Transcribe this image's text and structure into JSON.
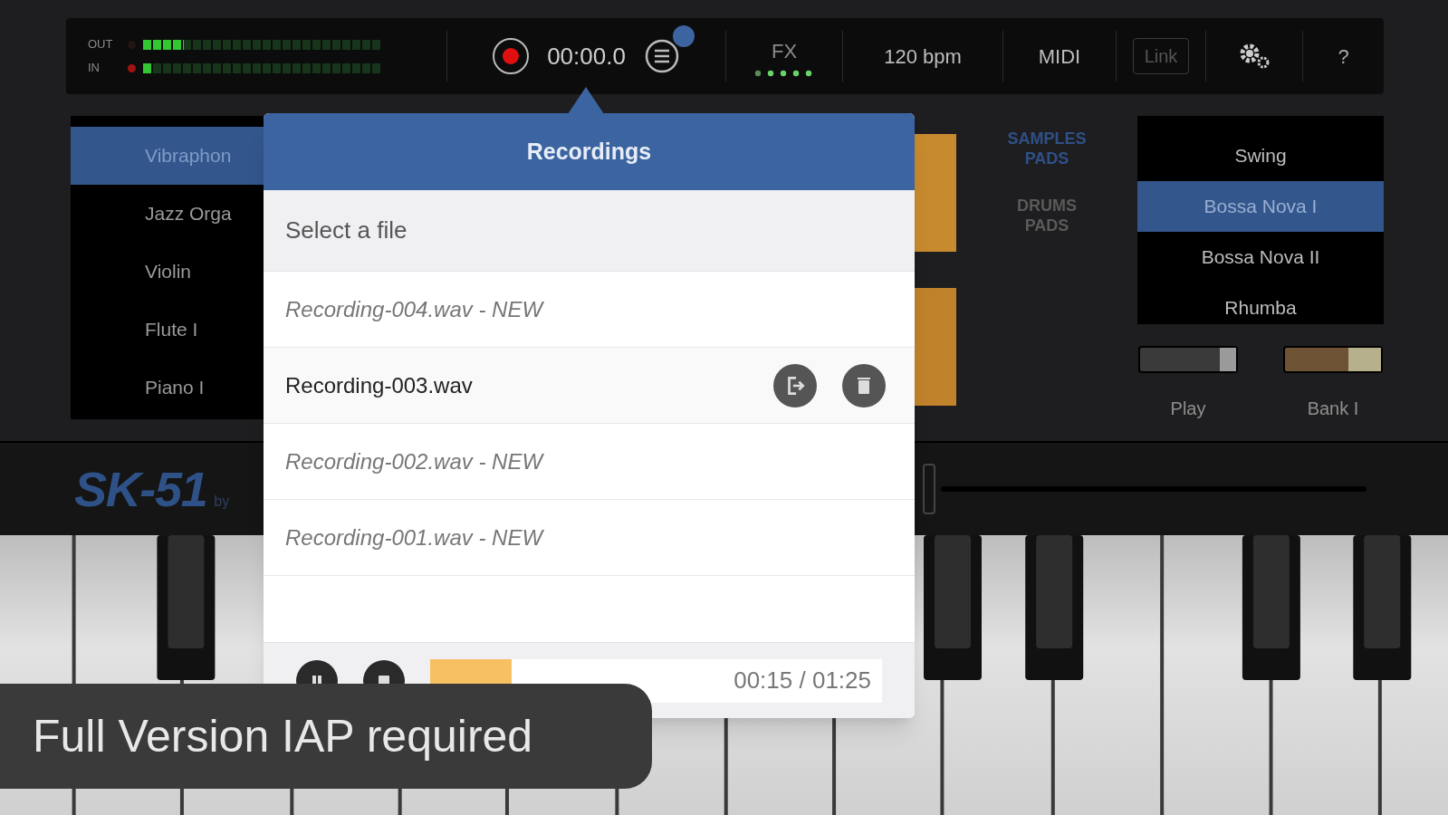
{
  "top_bar": {
    "meters": [
      {
        "label": "OUT",
        "level": 0.17,
        "clip": false
      },
      {
        "label": "IN",
        "level": 0.04,
        "clip": true
      }
    ],
    "time": "00:00.0",
    "fx": "FX",
    "tempo": "120 bpm",
    "midi": "MIDI",
    "link": "Link",
    "help": "?"
  },
  "instruments": [
    {
      "label": "Vibraphon",
      "selected": true
    },
    {
      "label": "Jazz Orga",
      "selected": false
    },
    {
      "label": "Violin",
      "selected": false
    },
    {
      "label": "Flute I",
      "selected": false
    },
    {
      "label": "Piano I",
      "selected": false
    }
  ],
  "pad_tabs": [
    {
      "label": "SAMPLES PADS",
      "selected": true
    },
    {
      "label": "DRUMS PADS",
      "selected": false
    }
  ],
  "styles": [
    {
      "label": "Swing",
      "selected": false
    },
    {
      "label": "Bossa Nova I",
      "selected": true
    },
    {
      "label": "Bossa Nova II",
      "selected": false
    },
    {
      "label": "Rhumba",
      "selected": false
    }
  ],
  "switches": [
    {
      "label": "Play",
      "on": false
    },
    {
      "label": "Bank I",
      "on": true
    }
  ],
  "logo": {
    "title": "SK-51",
    "byline": "by"
  },
  "popup": {
    "title": "Recordings",
    "subtitle": "Select a file",
    "files": [
      {
        "name": "Recording-004.wav - NEW",
        "selected": false
      },
      {
        "name": "Recording-003.wav",
        "selected": true
      },
      {
        "name": "Recording-002.wav - NEW",
        "selected": false
      },
      {
        "name": "Recording-001.wav - NEW",
        "selected": false
      }
    ],
    "player": {
      "level": 0.18,
      "time": "00:15 / 01:25"
    }
  },
  "toast": "Full Version IAP required"
}
